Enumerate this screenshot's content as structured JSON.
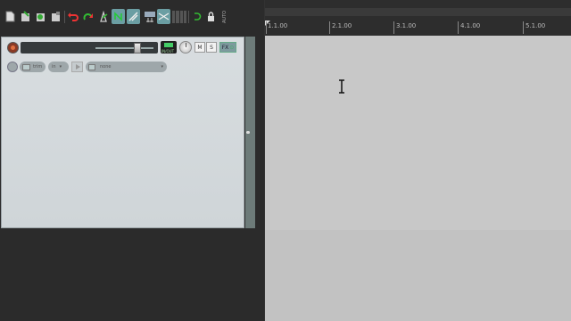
{
  "toolbar": {
    "icons": [
      "new-project-icon",
      "open-project-icon",
      "save-project-icon",
      "project-settings-icon",
      "undo-icon",
      "redo-icon",
      "metronome-icon",
      "grid-snap-icon",
      "ripple-edit-icon",
      "envelope-lock-icon",
      "mixer-meter-icon",
      "loop-icon",
      "lock-icon"
    ],
    "auto_label": "AUTO",
    "active_color": "#6b9ea3"
  },
  "track": {
    "io_label": "IN/OUT",
    "mute_label": "M",
    "solo_label": "S",
    "fx_label": "FX",
    "trim_label": "trim",
    "channel_label": "in",
    "input_label": "none"
  },
  "ruler": {
    "markers": [
      "1.1.00",
      "2.1.00",
      "3.1.00",
      "4.1.00",
      "5.1.00"
    ]
  },
  "colors": {
    "arrange_bg": "#c8c8c8",
    "tcp_bg": "#d8dde0",
    "record_arm": "#e07040"
  }
}
